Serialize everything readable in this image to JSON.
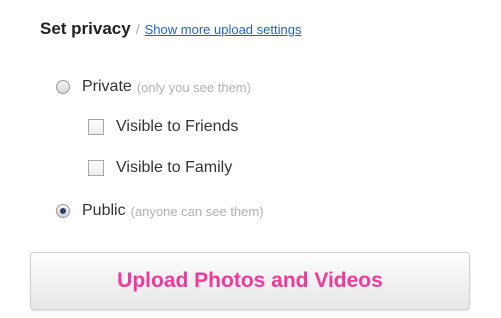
{
  "header": {
    "title": "Set privacy",
    "separator": "/",
    "more_link": "Show more upload settings"
  },
  "privacy": {
    "private": {
      "label": "Private",
      "hint": "(only you see them)",
      "selected": false
    },
    "friends": {
      "label": "Visible to Friends",
      "checked": false
    },
    "family": {
      "label": "Visible to Family",
      "checked": false
    },
    "public": {
      "label": "Public",
      "hint": "(anyone can see them)",
      "selected": true
    }
  },
  "upload_button": {
    "label": "Upload Photos and Videos"
  },
  "colors": {
    "upload_label": "#f0399a",
    "link": "#1a64c8"
  }
}
